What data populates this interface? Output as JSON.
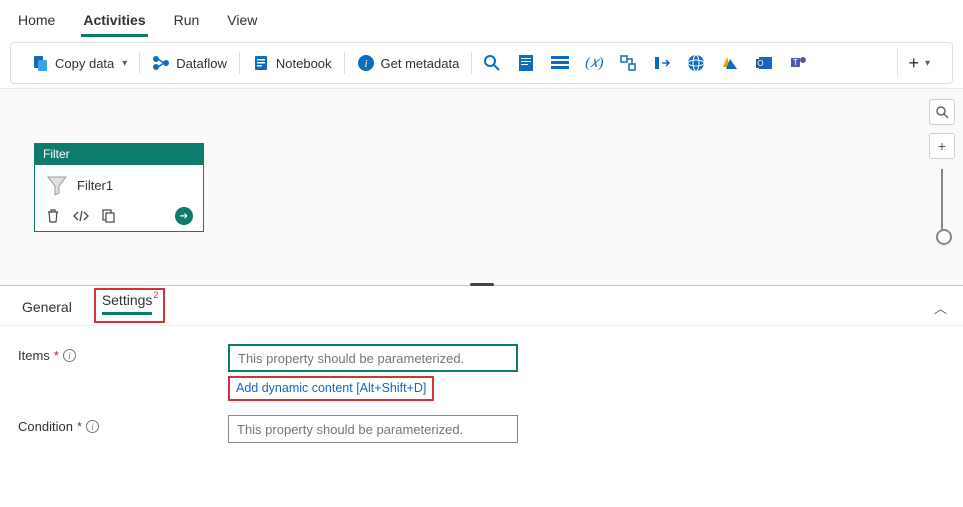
{
  "top_menu": {
    "home": "Home",
    "activities": "Activities",
    "run": "Run",
    "view": "View"
  },
  "toolbar": {
    "copy_data": "Copy data",
    "dataflow": "Dataflow",
    "notebook": "Notebook",
    "get_metadata": "Get metadata"
  },
  "activity": {
    "type_label": "Filter",
    "name": "Filter1"
  },
  "panel": {
    "tab_general": "General",
    "tab_settings": "Settings",
    "settings_badge": "2"
  },
  "form": {
    "items_label": "Items",
    "items_placeholder": "This property should be parameterized.",
    "condition_label": "Condition",
    "condition_placeholder": "This property should be parameterized.",
    "dynamic_link": "Add dynamic content [Alt+Shift+D]"
  }
}
